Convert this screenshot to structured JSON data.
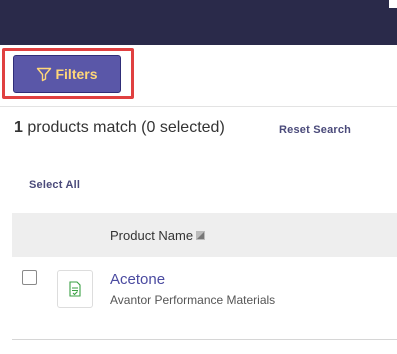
{
  "toolbar": {
    "filters_label": "Filters"
  },
  "results": {
    "count": "1",
    "summary_text": " products match (0 selected)",
    "reset_label": "Reset Search",
    "select_all_label": "Select All"
  },
  "table": {
    "columns": [
      {
        "label": "Product Name",
        "sortable": true
      }
    ],
    "rows": [
      {
        "product_name": "Acetone",
        "manufacturer": "Avantor Performance Materials",
        "checked": false,
        "thumbnail_icon": "sds-document-icon"
      }
    ]
  },
  "colors": {
    "topbar": "#2a2a4a",
    "button_bg": "#5a57a8",
    "button_text": "#ffd779",
    "highlight": "#e04040",
    "link": "#4a4aa0",
    "header_bg": "#eeeeee"
  },
  "icons": {
    "filter": "funnel-icon",
    "sort": "sort-icon",
    "thumbnail": "sds-document-icon"
  }
}
